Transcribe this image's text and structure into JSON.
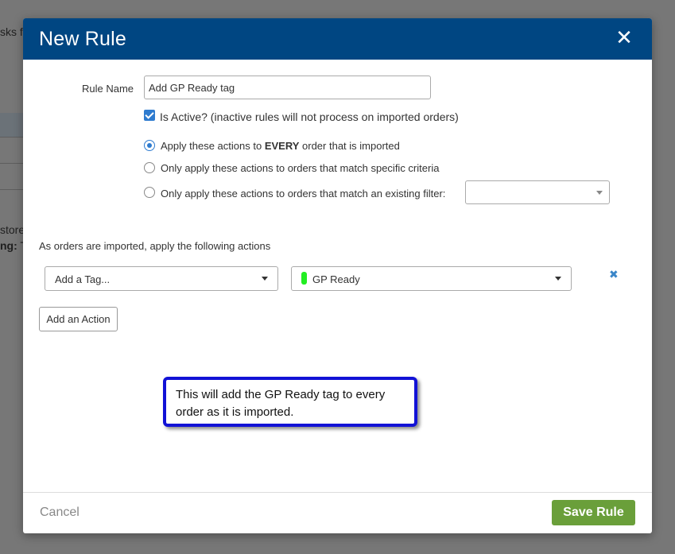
{
  "background": {
    "text_top": "sks f",
    "text_store": "store",
    "text_tag_bold": "ng:",
    "text_tag": " T"
  },
  "modal": {
    "title": "New Rule",
    "close_symbol": "✕"
  },
  "rule_name": {
    "label": "Rule Name",
    "value": "Add GP Ready tag"
  },
  "is_active": {
    "checked": true,
    "label": "Is Active? (inactive rules will not process on imported orders)"
  },
  "apply_options": [
    {
      "pre": "Apply these actions to ",
      "bold": "EVERY",
      "post": " order that is imported",
      "selected": true
    },
    {
      "pre": "Only apply these actions to orders that match specific criteria",
      "bold": "",
      "post": "",
      "selected": false
    },
    {
      "pre": "Only apply these actions to orders that match an existing filter:",
      "bold": "",
      "post": "",
      "selected": false
    }
  ],
  "filter_select": {
    "value": ""
  },
  "actions": {
    "heading": "As orders are imported, apply the following actions",
    "action_type": "Add a Tag...",
    "tag_value": "GP Ready",
    "tag_color": "#22ee22",
    "remove_symbol": "✖",
    "add_action_label": "Add an Action"
  },
  "callout": {
    "text": "This will add the GP Ready tag to every order as it is imported."
  },
  "footer": {
    "cancel_label": "Cancel",
    "save_label": "Save Rule"
  },
  "colors": {
    "header": "#004682",
    "accent": "#2e7bcf",
    "save": "#6a9f3a",
    "callout_border": "#1212d6"
  }
}
